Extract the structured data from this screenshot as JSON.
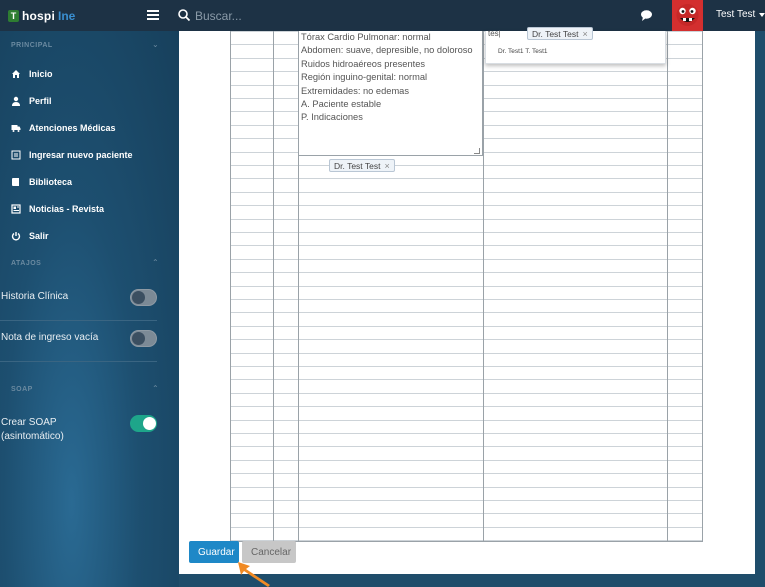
{
  "app": {
    "logo_badge": "T",
    "logo_part1": "hospi",
    "logo_part2": "Ine"
  },
  "header": {
    "search_placeholder": "Buscar...",
    "user_name": "Test Test",
    "icons": [
      "menu-icon",
      "search-icon",
      "chat-icon",
      "avatar"
    ]
  },
  "sidebar": {
    "principal_header": "PRINCIPAL",
    "items": [
      {
        "label": "Inicio",
        "icon": "home-icon"
      },
      {
        "label": "Perfil",
        "icon": "user-icon"
      },
      {
        "label": "Atenciones Médicas",
        "icon": "ambulance-icon"
      },
      {
        "label": "Ingresar nuevo paciente",
        "icon": "register-icon"
      },
      {
        "label": "Biblioteca",
        "icon": "book-icon"
      },
      {
        "label": "Noticias - Revista",
        "icon": "news-icon"
      },
      {
        "label": "Salir",
        "icon": "power-icon"
      }
    ],
    "atajos_header": "ATAJOS",
    "atajos": [
      {
        "label": "Historia Clínica",
        "on": false
      },
      {
        "label": "Nota de ingreso vacía",
        "on": false
      }
    ],
    "soap_header": "SOAP",
    "soap_option": {
      "line1": "Crear SOAP",
      "line2": "(asintomático)",
      "on": true
    }
  },
  "form": {
    "notes_lines": [
      "Tórax Cardio Pulmonar: normal",
      "Abdomen: suave, depresible, no doloroso",
      "Ruidos hidroaéreos presentes",
      "Región inguino-genital: normal",
      "Extremidades: no edemas",
      "A. Paciente estable",
      "P. Indicaciones"
    ],
    "doctor_tag": "Dr. Test Test",
    "dropdown_input": "tes|",
    "dropdown_tag": "Dr. Test Test",
    "dropdown_option": "Dr. Test1 T. Test1"
  },
  "buttons": {
    "save": "Guardar",
    "cancel": "Cancelar"
  },
  "colors": {
    "topbar": "#1d3245",
    "sidebar": "#1d4f70",
    "save_button": "#1e88c7",
    "toggle_on": "#1ea58a",
    "avatar_bg": "#d32f2f",
    "pointer": "#f08a24"
  }
}
